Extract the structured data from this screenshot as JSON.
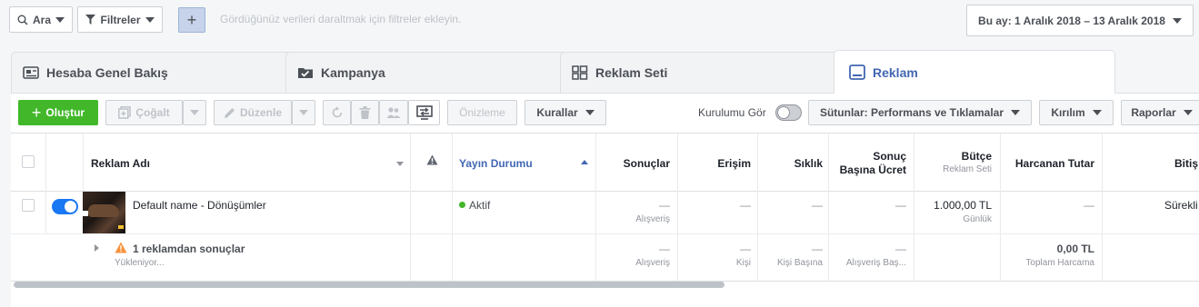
{
  "filter": {
    "search_label": "Ara",
    "filters_label": "Filtreler",
    "add_label": "+",
    "placeholder": "Gördüğünüz verileri daraltmak için filtreler ekleyin.",
    "date_range": "Bu ay: 1 Aralık 2018 – 13 Aralık 2018"
  },
  "tabs": [
    {
      "label": "Hesaba Genel Bakış"
    },
    {
      "label": "Kampanya"
    },
    {
      "label": "Reklam Seti"
    },
    {
      "label": "Reklam"
    }
  ],
  "toolbar": {
    "create": "Oluştur",
    "duplicate": "Çoğalt",
    "edit": "Düzenle",
    "preview": "Önizleme",
    "rules": "Kurallar",
    "setup_label": "Kurulumu Gör",
    "columns": "Sütunlar: Performans ve Tıklamalar",
    "breakdown": "Kırılım",
    "reports": "Raporlar"
  },
  "table": {
    "headers": {
      "name": "Reklam Adı",
      "status": "Yayın Durumu",
      "results": "Sonuçlar",
      "reach": "Erişim",
      "frequency": "Sıklık",
      "cpr_1": "Sonuç",
      "cpr_2": "Başına Ücret",
      "budget": "Bütçe",
      "budget_sub": "Reklam Seti",
      "spent": "Harcanan Tutar",
      "ends": "Bitiş"
    },
    "row": {
      "name": "Default name - Dönüşümler",
      "status": "Aktif",
      "results": "—",
      "results_sub": "Alışveriş",
      "reach": "—",
      "frequency": "—",
      "cpr": "—",
      "budget": "1.000,00 TL",
      "budget_sub": "Günlük",
      "spent": "—",
      "ends": "Sürekli"
    },
    "summary": {
      "title": "1 reklamdan sonuçlar",
      "loading": "Yükleniyor...",
      "results": "—",
      "results_sub": "Alışveriş",
      "reach": "—",
      "reach_sub": "Kişi",
      "frequency": "—",
      "frequency_sub": "Kişi Başına",
      "cpr": "—",
      "cpr_sub": "Alışveriş Baş...",
      "spent": "0,00 TL",
      "spent_sub": "Toplam Harcama"
    }
  }
}
